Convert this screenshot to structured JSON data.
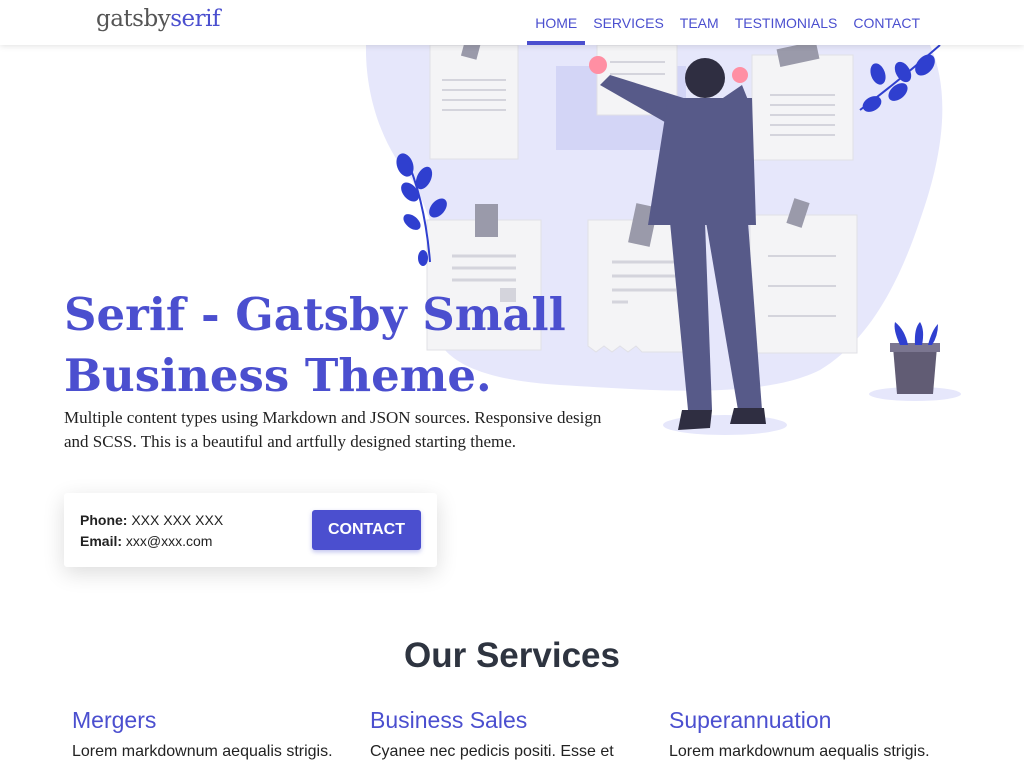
{
  "header": {
    "logo_part1": "gatsby",
    "logo_part2": "serif",
    "nav": [
      {
        "label": "HOME"
      },
      {
        "label": "SERVICES"
      },
      {
        "label": "TEAM"
      },
      {
        "label": "TESTIMONIALS"
      },
      {
        "label": "CONTACT"
      }
    ],
    "active_nav": "HOME"
  },
  "hero": {
    "title": "Serif - Gatsby Small Business Theme.",
    "description": "Multiple content types using Markdown and JSON sources. Responsive design and SCSS. This is a beautiful and artfully designed starting theme."
  },
  "contact_card": {
    "phone_label": "Phone:",
    "phone_value": "XXX XXX XXX",
    "email_label": "Email:",
    "email_value": "xxx@xxx.com",
    "button_label": "CONTACT"
  },
  "services": {
    "title": "Our Services",
    "items": [
      {
        "name": "Mergers",
        "text": "Lorem markdownum aequalis strigis."
      },
      {
        "name": "Business Sales",
        "text": "Cyanee nec pedicis positi. Esse et"
      },
      {
        "name": "Superannuation",
        "text": "Lorem markdownum aequalis strigis."
      }
    ]
  },
  "colors": {
    "accent": "#4b4fcf",
    "illustration_blob": "#e6e7fb",
    "leaf": "#2f3fcf",
    "figure_suit": "#575a89"
  }
}
